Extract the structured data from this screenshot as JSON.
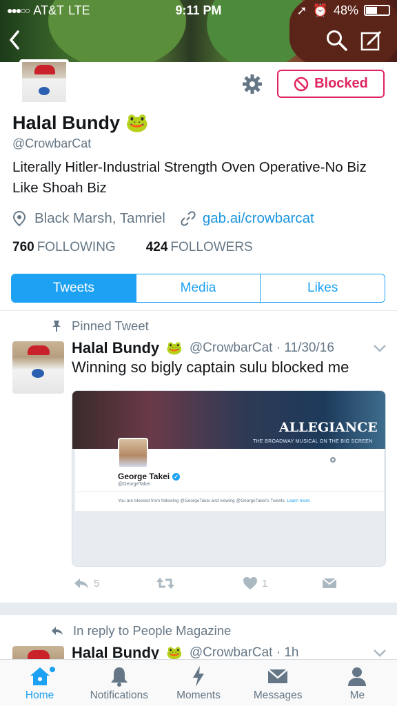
{
  "status_bar": {
    "carrier": "AT&T",
    "network": "LTE",
    "time": "9:11 PM",
    "battery": "48%"
  },
  "profile": {
    "name": "Halal Bundy",
    "handle": "@CrowbarCat",
    "bio": "Literally Hitler-Industrial Strength Oven Operative-No Biz Like Shoah Biz",
    "location": "Black Marsh, Tamriel",
    "url": "gab.ai/crowbarcat",
    "following_count": "760",
    "following_label": "FOLLOWING",
    "followers_count": "424",
    "followers_label": "FOLLOWERS",
    "blocked_label": "Blocked"
  },
  "tabs": [
    "Tweets",
    "Media",
    "Likes"
  ],
  "pinned_tweet": {
    "context_label": "Pinned Tweet",
    "name": "Halal Bundy",
    "handle": "@CrowbarCat",
    "date": "· 11/30/16",
    "text": "Winning so bigly captain sulu blocked me",
    "media": {
      "brand": "ALLEGIANCE",
      "subtitle": "THE BROADWAY MUSICAL ON THE BIG SCREEN",
      "account_name": "George Takei",
      "account_handle": "@GeorgeTakei",
      "notice": "You are blocked from following @GeorgeTakei and viewing @GeorgeTakei's Tweets.",
      "learn_more": "Learn more"
    },
    "reply_count": "5",
    "like_count": "1"
  },
  "second_tweet": {
    "context_label": "In reply to People Magazine",
    "name": "Halal Bundy",
    "handle": "@CrowbarCat",
    "date": "· 1h"
  },
  "bottom_nav": [
    "Home",
    "Notifications",
    "Moments",
    "Messages",
    "Me"
  ],
  "colors": {
    "accent": "#1da1f2",
    "blocked": "#e0245e",
    "muted": "#657786"
  }
}
